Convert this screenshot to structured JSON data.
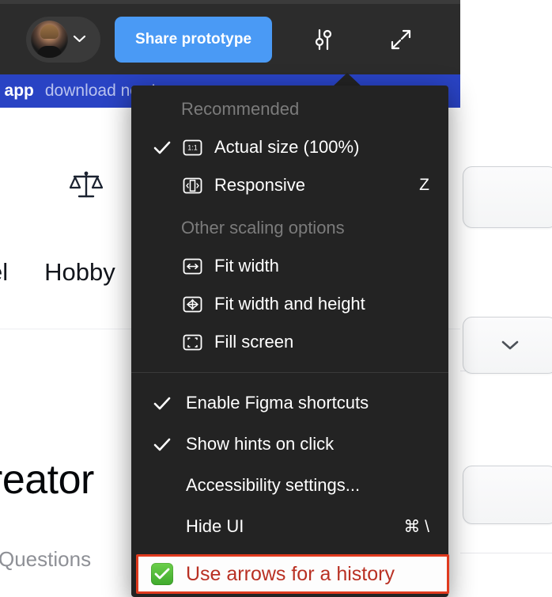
{
  "toolbar": {
    "avatar_name": "user-avatar",
    "account_caret": "chevron-down-icon",
    "share_label": "Share prototype",
    "settings_icon": "sliders-icon",
    "fullscreen_icon": "expand-arrows-icon"
  },
  "promo": {
    "strong": "e app",
    "rest": "download now!"
  },
  "content": {
    "scales_icon": "balance-scales-icon",
    "tier_left": "el",
    "tier_right": "Hobby",
    "heading": "reator",
    "sub_label": "Questions",
    "card_chevron": "chevron-down-icon"
  },
  "menu": {
    "sections": [
      {
        "title": "Recommended"
      },
      {
        "title": "Other scaling options"
      }
    ],
    "items": [
      {
        "label": "Actual size (100%)",
        "icon": "one-to-one-icon",
        "checked": true,
        "shortcut": ""
      },
      {
        "label": "Responsive",
        "icon": "responsive-icon",
        "checked": false,
        "shortcut": "Z"
      },
      {
        "label": "Fit width",
        "icon": "fit-width-icon",
        "checked": false,
        "shortcut": ""
      },
      {
        "label": "Fit width and height",
        "icon": "fit-width-height-icon",
        "checked": false,
        "shortcut": ""
      },
      {
        "label": "Fill screen",
        "icon": "fill-screen-icon",
        "checked": false,
        "shortcut": ""
      },
      {
        "label": "Enable Figma shortcuts",
        "icon": "",
        "checked": true,
        "shortcut": ""
      },
      {
        "label": "Show hints on click",
        "icon": "",
        "checked": true,
        "shortcut": ""
      },
      {
        "label": "Accessibility settings...",
        "icon": "",
        "checked": false,
        "shortcut": ""
      },
      {
        "label": "Hide UI",
        "icon": "",
        "checked": false,
        "shortcut": "⌘ \\"
      }
    ]
  },
  "annotation": {
    "label": "Use arrows for a history",
    "check_icon": "green-check-icon",
    "border_color": "#e03a1e",
    "text_color": "#b93023"
  },
  "colors": {
    "menu_bg": "#232323",
    "toolbar_bg": "#2c2c2c",
    "share_button": "#4a9af5",
    "promo_banner": "#2943c4",
    "muted_text": "#7b7b7b"
  }
}
